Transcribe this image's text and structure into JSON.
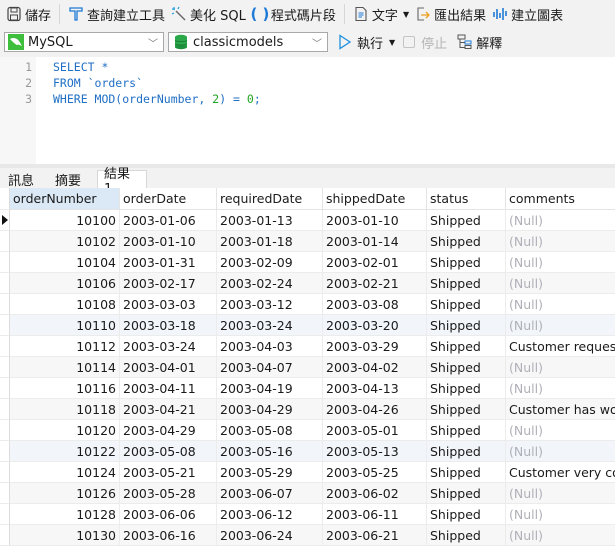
{
  "toolbar": {
    "save": "儲存",
    "query_builder": "查詢建立工具",
    "beautify": "美化 SQL",
    "snippets": "程式碼片段",
    "text": "文字",
    "export": "匯出結果",
    "chart": "建立圖表"
  },
  "connection": {
    "value": "MySQL"
  },
  "database": {
    "value": "classicmodels"
  },
  "run": {
    "run": "執行",
    "stop": "停止",
    "explain": "解釋"
  },
  "editor": {
    "lines": [
      {
        "no": "1",
        "code": "SELECT *"
      },
      {
        "no": "2",
        "code": "FROM `orders`"
      },
      {
        "no": "3",
        "code_prefix": "WHERE MOD(orderNumber, ",
        "code_num": "2",
        "code_mid": ") = ",
        "code_num2": "0",
        "code_suffix": ";"
      }
    ]
  },
  "result_tabs": [
    {
      "label": "訊息"
    },
    {
      "label": "摘要"
    },
    {
      "label": "結果 1",
      "active": true
    }
  ],
  "table": {
    "columns": [
      "orderNumber",
      "orderDate",
      "requiredDate",
      "shippedDate",
      "status",
      "comments"
    ],
    "rows": [
      [
        "10100",
        "2003-01-06",
        "2003-01-13",
        "2003-01-10",
        "Shipped",
        "(Null)"
      ],
      [
        "10102",
        "2003-01-10",
        "2003-01-18",
        "2003-01-14",
        "Shipped",
        "(Null)"
      ],
      [
        "10104",
        "2003-01-31",
        "2003-02-09",
        "2003-02-01",
        "Shipped",
        "(Null)"
      ],
      [
        "10106",
        "2003-02-17",
        "2003-02-24",
        "2003-02-21",
        "Shipped",
        "(Null)"
      ],
      [
        "10108",
        "2003-03-03",
        "2003-03-12",
        "2003-03-08",
        "Shipped",
        "(Null)"
      ],
      [
        "10110",
        "2003-03-18",
        "2003-03-24",
        "2003-03-20",
        "Shipped",
        "(Null)"
      ],
      [
        "10112",
        "2003-03-24",
        "2003-04-03",
        "2003-03-29",
        "Shipped",
        "Customer requeste"
      ],
      [
        "10114",
        "2003-04-01",
        "2003-04-07",
        "2003-04-02",
        "Shipped",
        "(Null)"
      ],
      [
        "10116",
        "2003-04-11",
        "2003-04-19",
        "2003-04-13",
        "Shipped",
        "(Null)"
      ],
      [
        "10118",
        "2003-04-21",
        "2003-04-29",
        "2003-04-26",
        "Shipped",
        "Customer has work"
      ],
      [
        "10120",
        "2003-04-29",
        "2003-05-08",
        "2003-05-01",
        "Shipped",
        "(Null)"
      ],
      [
        "10122",
        "2003-05-08",
        "2003-05-16",
        "2003-05-13",
        "Shipped",
        "(Null)"
      ],
      [
        "10124",
        "2003-05-21",
        "2003-05-29",
        "2003-05-25",
        "Shipped",
        "Customer very con"
      ],
      [
        "10126",
        "2003-05-28",
        "2003-06-07",
        "2003-06-02",
        "Shipped",
        "(Null)"
      ],
      [
        "10128",
        "2003-06-06",
        "2003-06-12",
        "2003-06-11",
        "Shipped",
        "(Null)"
      ],
      [
        "10130",
        "2003-06-16",
        "2003-06-24",
        "2003-06-21",
        "Shipped",
        "(Null)"
      ]
    ],
    "highlighted_rows": [
      5,
      11
    ],
    "current_row": 0
  }
}
